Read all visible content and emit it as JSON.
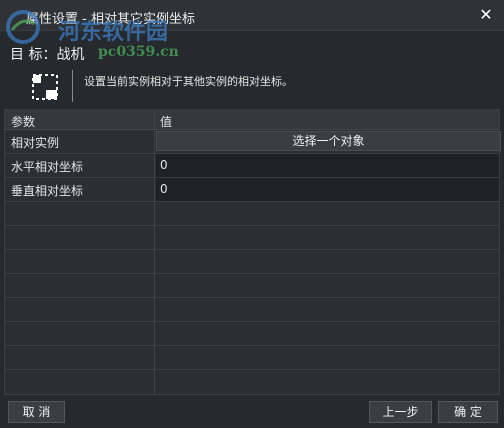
{
  "window": {
    "title": "属性设置 - 相对其它实例坐标",
    "close_label": "✕"
  },
  "watermark": {
    "logo_name": "hedong-logo",
    "text": "河东软件园",
    "url": "pc0359.cn"
  },
  "target": {
    "text": "目 标：战机"
  },
  "description": {
    "icon": "relative-position-icon",
    "text": "设置当前实例相对于其他实例的相对坐标。"
  },
  "table": {
    "headers": [
      "参数",
      "值"
    ],
    "rows": [
      {
        "label": "相对实例",
        "value": "选择一个对象"
      },
      {
        "label": "水平相对坐标",
        "value": "0"
      },
      {
        "label": "垂直相对坐标",
        "value": "0"
      }
    ]
  },
  "footer": {
    "cancel_label": "取 消",
    "prev_label": "上一步",
    "ok_label": "确 定"
  },
  "colors": {
    "background": "#26292d",
    "grid_background": "#2b2e32",
    "header_background": "#35383c",
    "button_background": "#3a3d41",
    "watermark_blue": "#3c7ec6",
    "watermark_green": "#4aa55a"
  }
}
